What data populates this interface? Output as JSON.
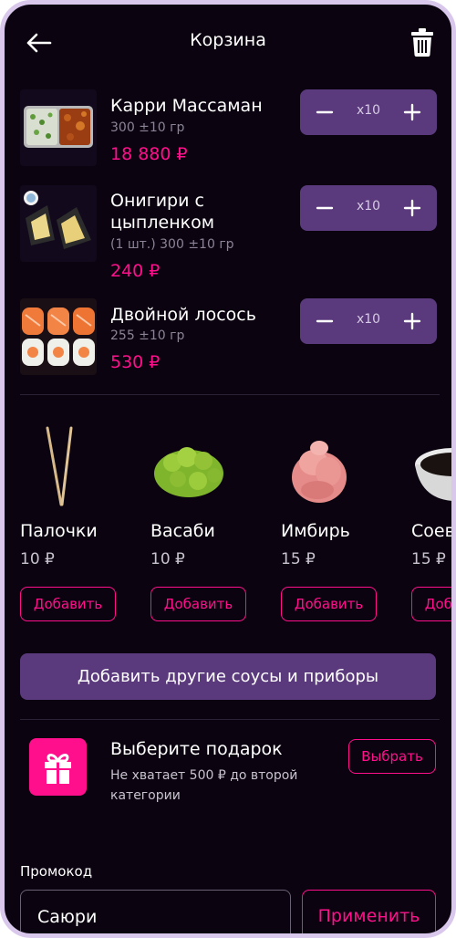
{
  "header": {
    "title": "Корзина"
  },
  "cart_items": [
    {
      "name": "Карри Массаман",
      "weight": "300 ±10 гр",
      "price": "18 880 ₽",
      "quantity": "x10"
    },
    {
      "name": "Онигири с цыпленком",
      "weight": "(1 шт.) 300 ±10 гр",
      "price": "240 ₽",
      "quantity": "x10"
    },
    {
      "name": "Двойной лосось",
      "weight": "255 ±10 гр",
      "price": "530 ₽",
      "quantity": "x10"
    }
  ],
  "addons": [
    {
      "name": "Палочки",
      "price": "10 ₽",
      "button": "Добавить"
    },
    {
      "name": "Васаби",
      "price": "10 ₽",
      "button": "Добавить"
    },
    {
      "name": "Имбирь",
      "price": "15 ₽",
      "button": "Добавить"
    },
    {
      "name": "Соевый соус",
      "price": "15 ₽",
      "button": "Добавить"
    }
  ],
  "add_more_button": "Добавить другие соусы и приборы",
  "gift": {
    "title": "Выберите подарок",
    "description": "Не хватает 500 ₽ до второй категории",
    "button": "Выбрать"
  },
  "promo": {
    "label": "Промокод",
    "value": "Саюри",
    "apply_button": "Применить"
  },
  "colors": {
    "background": "#0b0410",
    "accent": "#ff0f8b",
    "button": "#5a3a7c"
  }
}
